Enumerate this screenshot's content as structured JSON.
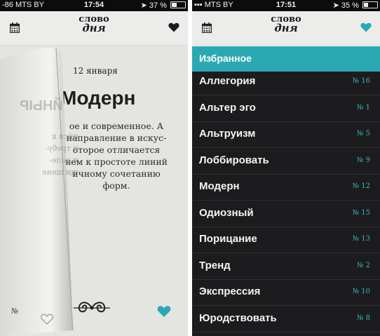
{
  "colors": {
    "accent_teal": "#2aa9b3",
    "list_background": "#1c1c1e",
    "paper": "#e4e4e1",
    "status_bar": "#0c0c0c"
  },
  "left_screen": {
    "status": {
      "signal": "-86 MTS BY",
      "time": "17:54",
      "battery": "37 %",
      "battery_level": 0.37
    },
    "logo": {
      "line1": "слово",
      "line2": "дня"
    },
    "date": "12 января",
    "word": "Модерн",
    "description_lines": [
      "ое и современное. А",
      "направление в искус-",
      "оторое отличается",
      "ием к простоте линий",
      "ичному сочетанию",
      "форм."
    ],
    "page_title_mirrored": "ЙНЫР",
    "page_lines": [
      "ийся к",
      "и требу-",
      "и деле-",
      "щи шене"
    ],
    "number_partial": "№",
    "icons": {
      "calendar": "calendar-icon",
      "favorites": "heart-icon",
      "favorite_toggle_outline": "heart-outline-icon",
      "favorite_active": "heart-filled-icon",
      "ornament": "ornament-flourish"
    }
  },
  "right_screen": {
    "status": {
      "signal": "MTS BY",
      "time": "17:51",
      "battery": "35 %",
      "battery_level": 0.35
    },
    "logo": {
      "line1": "слово",
      "line2": "дня"
    },
    "section_title": "Избранное",
    "items": [
      {
        "word": "Аллегория",
        "num": "№ 16"
      },
      {
        "word": "Альтер эго",
        "num": "№ 1"
      },
      {
        "word": "Альтруизм",
        "num": "№ 5"
      },
      {
        "word": "Лоббировать",
        "num": "№ 9"
      },
      {
        "word": "Модерн",
        "num": "№ 12"
      },
      {
        "word": "Одиозный",
        "num": "№ 15"
      },
      {
        "word": "Порицание",
        "num": "№ 13"
      },
      {
        "word": "Тренд",
        "num": "№ 2"
      },
      {
        "word": "Экспрессия",
        "num": "№ 10"
      },
      {
        "word": "Юродствовать",
        "num": "№ 8"
      }
    ]
  }
}
